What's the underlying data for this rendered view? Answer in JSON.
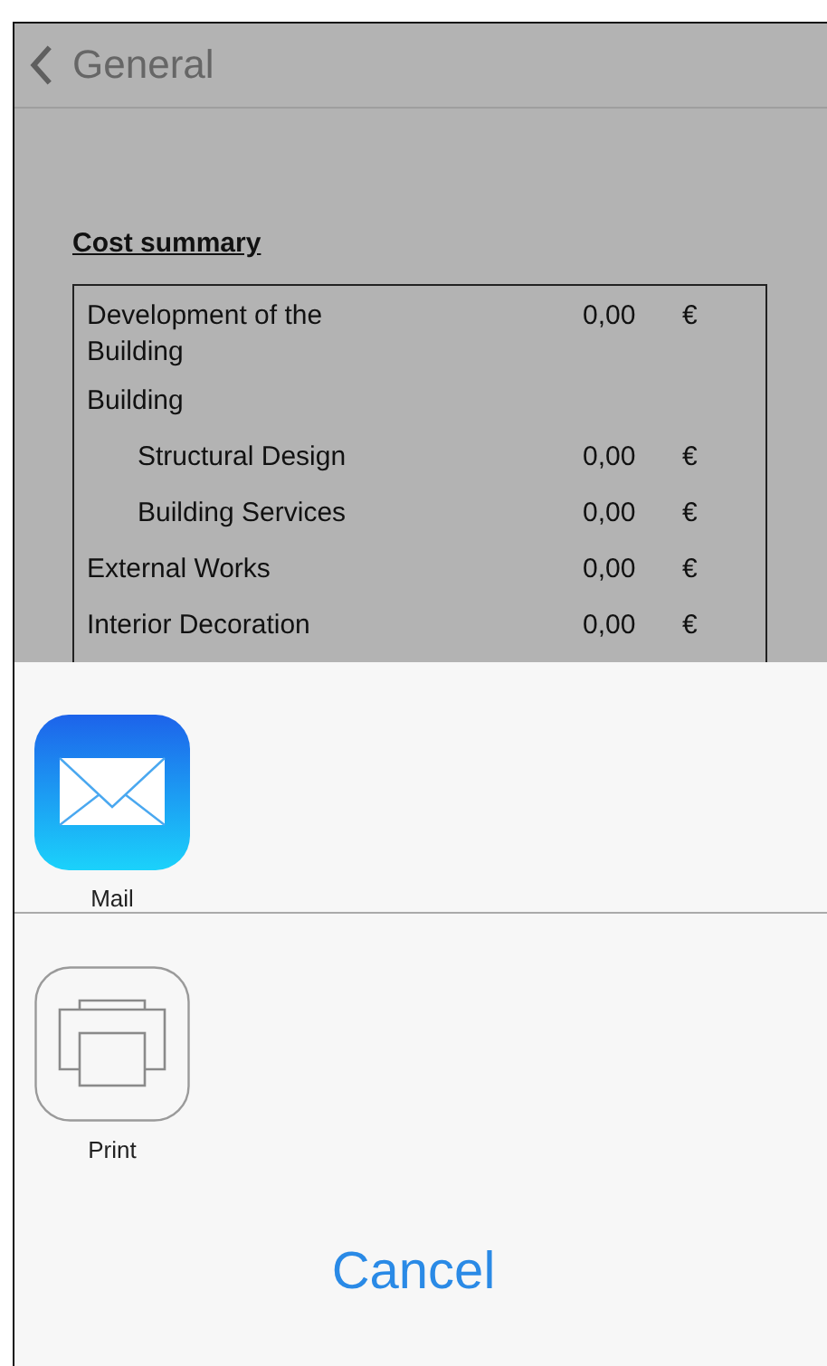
{
  "nav": {
    "back_label": "General"
  },
  "document": {
    "title": "Cost summary",
    "rows": [
      {
        "label": "Development of  the Building",
        "amount": "0,00",
        "currency": "€"
      },
      {
        "label": "Building",
        "children": [
          {
            "label": "Structural Design",
            "amount": "0,00",
            "currency": "€"
          },
          {
            "label": "Building Services",
            "amount": "0,00",
            "currency": "€"
          }
        ]
      },
      {
        "label": "External Works",
        "amount": "0,00",
        "currency": "€"
      },
      {
        "label": "Interior Decoration",
        "amount": "0,00",
        "currency": "€"
      }
    ]
  },
  "share_sheet": {
    "groups": [
      {
        "items": [
          {
            "kind": "mail",
            "label": "Mail"
          }
        ]
      },
      {
        "items": [
          {
            "kind": "print",
            "label": "Print"
          }
        ]
      }
    ],
    "cancel": "Cancel"
  }
}
